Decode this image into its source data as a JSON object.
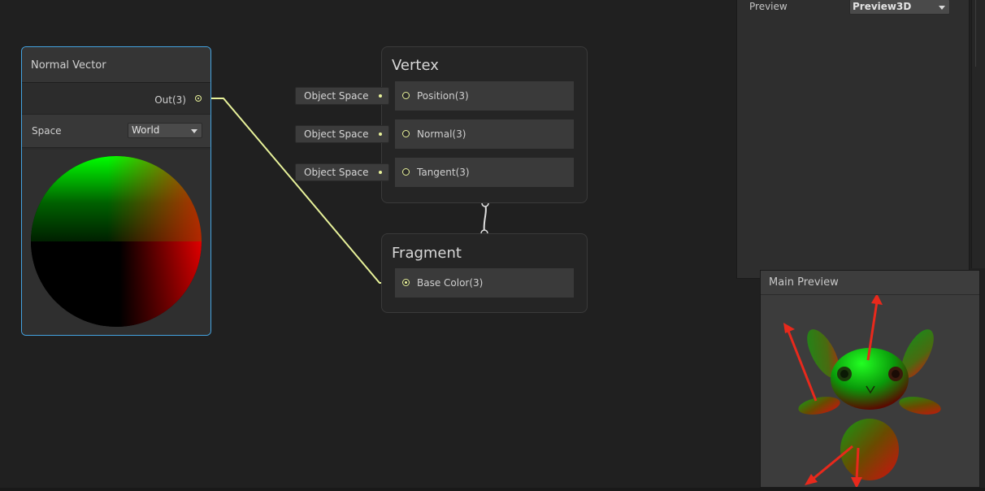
{
  "normal_vector_node": {
    "title": "Normal Vector",
    "output_label": "Out(3)",
    "space_label": "Space",
    "space_value": "World"
  },
  "vertex_node": {
    "title": "Vertex",
    "slots": [
      {
        "label": "Position(3)",
        "space": "Object Space"
      },
      {
        "label": "Normal(3)",
        "space": "Object Space"
      },
      {
        "label": "Tangent(3)",
        "space": "Object Space"
      }
    ]
  },
  "fragment_node": {
    "title": "Fragment",
    "slots": [
      {
        "label": "Base Color(3)"
      }
    ]
  },
  "graph_settings": {
    "preview_label": "Preview",
    "preview_value": "Preview3D"
  },
  "main_preview": {
    "title": "Main Preview"
  },
  "colors": {
    "node_selected_border": "#44a3e0",
    "wire": "#e8f29a",
    "annotation_arrow": "#e8291c"
  }
}
